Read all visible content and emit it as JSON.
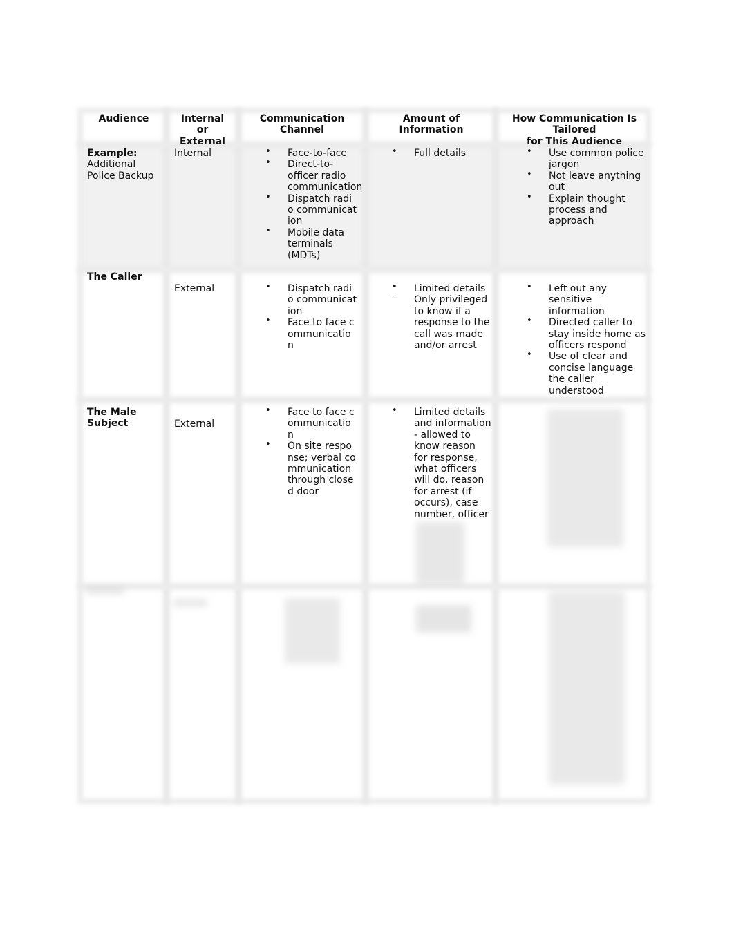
{
  "table": {
    "headers": [
      "Audience",
      "Internal or External",
      "Communication Channel",
      "Amount of Information",
      "How Communication Is Tailored for This Audience"
    ],
    "header_lines": {
      "audience": [
        "Audience"
      ],
      "internal_external": [
        "Internal",
        "or",
        "External"
      ],
      "channel": [
        "Communication",
        "Channel"
      ],
      "amount": [
        "Amount of",
        "Information"
      ],
      "tailored": [
        "How Communication Is",
        "Tailored",
        "for This Audience"
      ]
    },
    "rows": [
      {
        "audience_bold": "Example:",
        "audience_rest": "Additional Police Backup",
        "internal_external": "Internal",
        "channel": [
          "Face-to-face",
          "Direct-to-officer radio communication",
          "Dispatch radio communication",
          "Mobile data terminals (MDTs)"
        ],
        "amount": [
          "Full details"
        ],
        "tailored": [
          "Use common police jargon",
          "Not leave anything out",
          "Explain thought process and approach"
        ],
        "shaded": true
      },
      {
        "audience_bold": "The Caller",
        "internal_external": "External",
        "channel": [
          "Dispatch radio communication",
          "Face to face communication"
        ],
        "amount": [
          "Limited details",
          "Only privileged to know if a response to the call was made and/or arrest"
        ],
        "amount_bullets": [
          "•",
          "-"
        ],
        "tailored": [
          "Left out any sensitive information",
          "Directed caller to stay inside home as officers respond",
          "Use of clear and concise language the caller understood"
        ]
      },
      {
        "audience_bold": "The Male Subject",
        "internal_external": "External",
        "channel": [
          "Face to face communication",
          "On site response; verbal communication through closed door"
        ],
        "amount": [
          "Limited details and information - allowed to know reason for response, what officers will do, reason for arrest (if occurs), case number, officer"
        ],
        "amount_obscured_note": "[obscured text]",
        "tailored_obscured_note": "[obscured text]"
      },
      {
        "obscured": true,
        "note": "[obscured row]"
      }
    ],
    "bullet": "•"
  }
}
